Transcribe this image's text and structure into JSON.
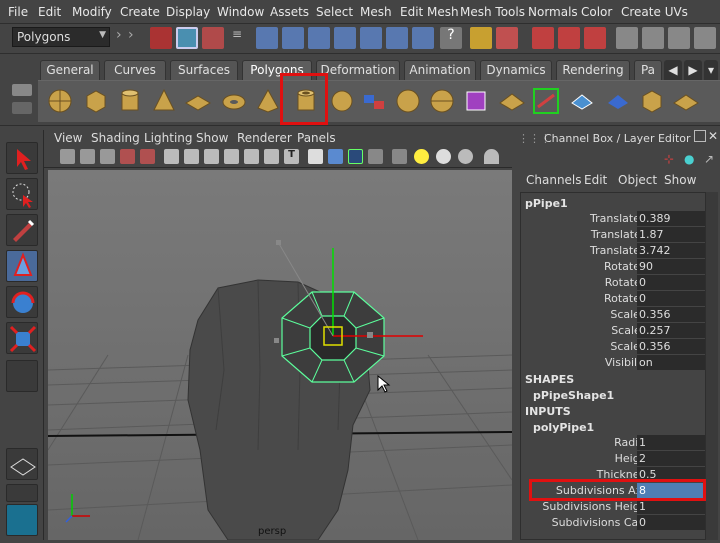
{
  "menubar": [
    "File",
    "Edit",
    "Modify",
    "Create",
    "Display",
    "Window",
    "Assets",
    "Select",
    "Mesh",
    "Edit Mesh",
    "Mesh Tools",
    "Normals",
    "Color",
    "Create UVs"
  ],
  "statusline": {
    "mode": "Polygons"
  },
  "shelf": {
    "tabs": [
      "General",
      "Curves",
      "Surfaces",
      "Polygons",
      "Deformation",
      "Animation",
      "Dynamics",
      "Rendering",
      "Pa"
    ],
    "active_tab": "Polygons",
    "highlighted_icon": "pipe-icon"
  },
  "panel": {
    "menu": [
      "View",
      "Shading",
      "Lighting",
      "Show",
      "Renderer",
      "Panels"
    ],
    "camera_label": "persp"
  },
  "channel_box": {
    "title": "Channel Box / Layer Editor",
    "menu": [
      "Channels",
      "Edit",
      "Object",
      "Show"
    ],
    "object_name": "pPipe1",
    "transforms": [
      {
        "name": "Translate X",
        "value": "0.389"
      },
      {
        "name": "Translate Y",
        "value": "1.87"
      },
      {
        "name": "Translate Z",
        "value": "3.742"
      },
      {
        "name": "Rotate X",
        "value": "90"
      },
      {
        "name": "Rotate Y",
        "value": "0"
      },
      {
        "name": "Rotate Z",
        "value": "0"
      },
      {
        "name": "Scale X",
        "value": "0.356"
      },
      {
        "name": "Scale Y",
        "value": "0.257"
      },
      {
        "name": "Scale Z",
        "value": "0.356"
      },
      {
        "name": "Visibility",
        "value": "on"
      }
    ],
    "shapes_header": "SHAPES",
    "shape_name": "pPipeShape1",
    "inputs_header": "INPUTS",
    "input_name": "polyPipe1",
    "inputs": [
      {
        "name": "Radius",
        "value": "1"
      },
      {
        "name": "Height",
        "value": "2"
      },
      {
        "name": "Thickness",
        "value": "0.5"
      },
      {
        "name": "Subdivisions Axis",
        "value": "8"
      },
      {
        "name": "Subdivisions Height",
        "value": "1"
      },
      {
        "name": "Subdivisions Caps",
        "value": "0"
      }
    ]
  },
  "colors": {
    "highlight_red": "#e01010",
    "selection_green": "#5cff9c",
    "manip_green": "#00e000",
    "manip_red": "#e00000",
    "manip_yellow": "#e0e000"
  }
}
